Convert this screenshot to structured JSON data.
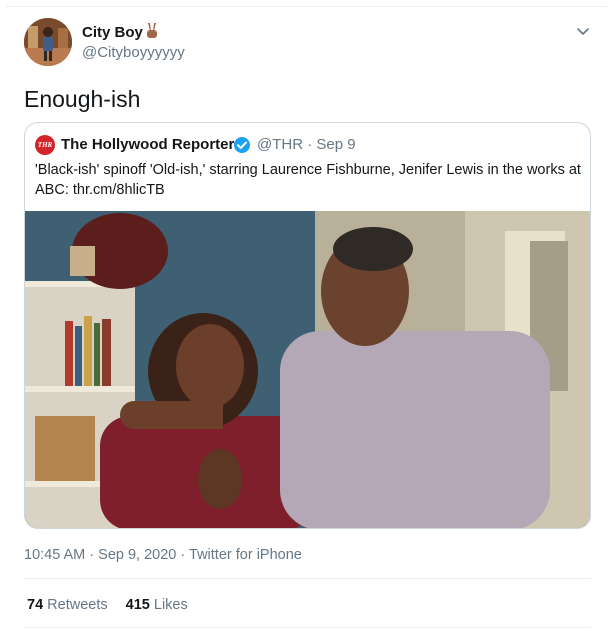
{
  "tweet": {
    "author_name": "City Boy",
    "author_handle": "@Cityboyyyyyy",
    "author_emoji": "victory-hand-icon",
    "text": "Enough-ish",
    "timestamp": "10:45 AM",
    "date": "Sep 9, 2020",
    "source": "Twitter for iPhone",
    "retweets_count": "74",
    "retweets_label": "Retweets",
    "likes_count": "415",
    "likes_label": "Likes"
  },
  "quoted": {
    "logo_text": "THR",
    "author_name": "The Hollywood Reporter",
    "verified": true,
    "handle_date": "@THR · Sep 9",
    "text": "'Black-ish' spinoff 'Old-ish,' starring Laurence Fishburne, Jenifer Lewis in the works at ABC: thr.cm/8hlicTB"
  },
  "colors": {
    "text_primary": "#14171a",
    "text_secondary": "#657786",
    "border": "#ccd6dd",
    "divider": "#e6ecf0",
    "verified_blue": "#1da1f2",
    "thr_red": "#d4242b"
  }
}
